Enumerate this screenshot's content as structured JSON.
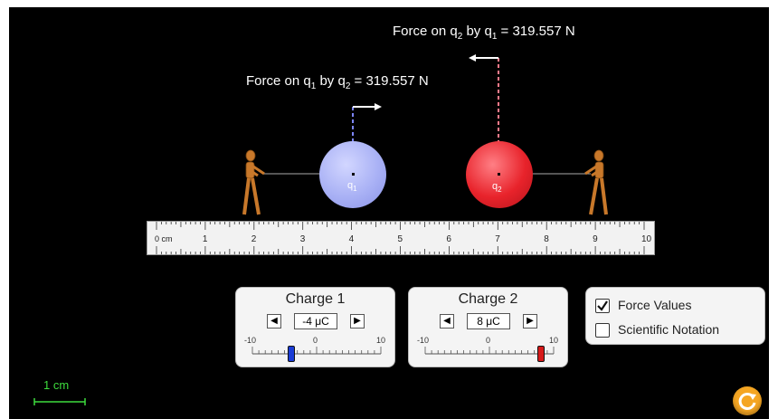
{
  "force_labels": {
    "q2": {
      "prefix": "Force on q",
      "sub_a": "2",
      "mid": " by q",
      "sub_b": "1",
      "value": " = 319.557 N"
    },
    "q1": {
      "prefix": "Force on q",
      "sub_a": "1",
      "mid": " by q",
      "sub_b": "2",
      "value": " = 319.557 N"
    }
  },
  "charges": {
    "q1_label": "q1",
    "q2_label": "q2",
    "q1_color": "#a9b1f5",
    "q2_color": "#e8232b"
  },
  "ruler": {
    "unit": "cm",
    "labels": [
      "0 cm",
      "1",
      "2",
      "3",
      "4",
      "5",
      "6",
      "7",
      "8",
      "9",
      "10"
    ]
  },
  "charge1": {
    "title": "Charge 1",
    "value": "-4 μC",
    "min": "-10",
    "mid": "0",
    "max": "10",
    "level": -4,
    "thumb_color": "#1a3cd6"
  },
  "charge2": {
    "title": "Charge 2",
    "value": "8 μC",
    "min": "-10",
    "mid": "0",
    "max": "10",
    "level": 8,
    "thumb_color": "#d61a1a"
  },
  "options": {
    "force_values": {
      "label": "Force Values",
      "checked": true
    },
    "scientific_notation": {
      "label": "Scientific Notation",
      "checked": false
    }
  },
  "scale": {
    "label": "1 cm",
    "color": "#3ddc3d"
  },
  "reset": {
    "color": "#f5a623"
  }
}
